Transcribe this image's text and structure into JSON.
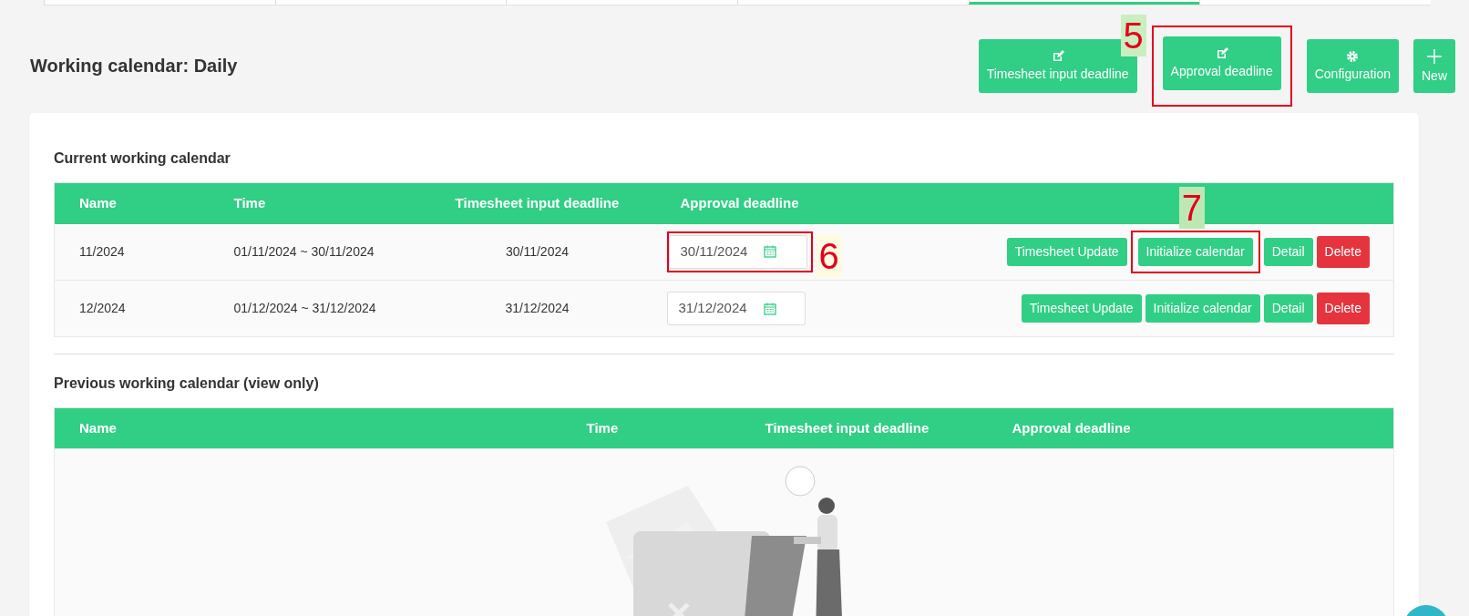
{
  "top_tabs": [
    {
      "selected": false
    },
    {
      "selected": false
    },
    {
      "selected": false
    },
    {
      "selected": false
    },
    {
      "selected": true
    },
    {
      "selected": false
    }
  ],
  "page_title": "Working calendar: Daily",
  "toolbar": [
    {
      "label": "Timesheet input deadline"
    },
    {
      "label": "Approval deadline",
      "callout": "5"
    },
    {
      "label": "Configuration"
    },
    {
      "label": "New"
    }
  ],
  "current": {
    "title": "Current working calendar",
    "columns": [
      "Name",
      "Time",
      "Timesheet input deadline",
      "Approval deadline"
    ],
    "rows": [
      {
        "name": "11/2024",
        "time": "01/11/2024 ~ 30/11/2024",
        "timesheet_deadline": "30/11/2024",
        "approval_deadline": "30/11/2024",
        "approval_callout": "6",
        "actions": [
          {
            "label": "Timesheet Update",
            "kind": "primary"
          },
          {
            "label": "Initialize calendar",
            "kind": "primary",
            "callout": "7"
          },
          {
            "label": "Detail",
            "kind": "primary"
          },
          {
            "label": "Delete",
            "kind": "danger"
          }
        ]
      },
      {
        "name": "12/2024",
        "time": "01/12/2024 ~ 31/12/2024",
        "timesheet_deadline": "31/12/2024",
        "approval_deadline": "31/12/2024",
        "actions": [
          {
            "label": "Timesheet Update",
            "kind": "primary"
          },
          {
            "label": "Initialize calendar",
            "kind": "primary"
          },
          {
            "label": "Detail",
            "kind": "primary"
          },
          {
            "label": "Delete",
            "kind": "danger"
          }
        ]
      }
    ]
  },
  "previous": {
    "title": "Previous working calendar (view only)",
    "columns": [
      "Name",
      "Time",
      "Timesheet input deadline",
      "Approval deadline"
    ]
  }
}
